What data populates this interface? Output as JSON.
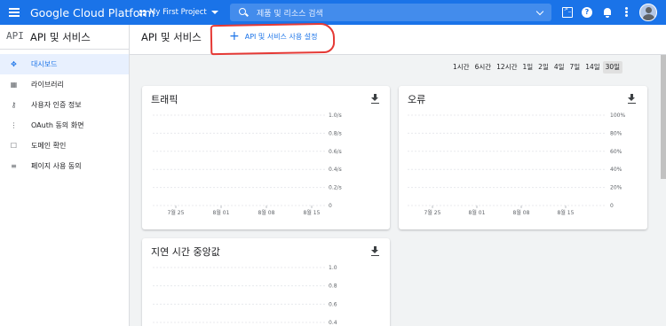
{
  "topbar": {
    "brand": "Google Cloud Platform",
    "project": "My First Project",
    "search_placeholder": "제품 및 리소스 검색",
    "help": "?",
    "colors": {
      "bar": "#1a73e8"
    }
  },
  "sidebar": {
    "api_logo": "API",
    "title": "API 및 서비스",
    "items": [
      {
        "label": "대시보드",
        "icon": "dashboard-icon",
        "glyph": "✥",
        "active": true
      },
      {
        "label": "라이브러리",
        "icon": "library-icon",
        "glyph": "▦",
        "active": false
      },
      {
        "label": "사용자 인증 정보",
        "icon": "key-icon",
        "glyph": "⚷",
        "active": false
      },
      {
        "label": "OAuth 동의 화면",
        "icon": "consent-icon",
        "glyph": "⋮",
        "active": false
      },
      {
        "label": "도메인 확인",
        "icon": "domain-icon",
        "glyph": "☐",
        "active": false
      },
      {
        "label": "페이지 사용 동의",
        "icon": "settings-list-icon",
        "glyph": "≡",
        "active": false
      }
    ]
  },
  "header": {
    "title": "API 및 서비스",
    "enable_button": "API 및 서비스 사용 설정",
    "enable_plus": "+"
  },
  "ranges": [
    "1시간",
    "6시간",
    "12시간",
    "1일",
    "2일",
    "4일",
    "7일",
    "14일",
    "30일"
  ],
  "ranges_selected": "30일",
  "chart_data": [
    {
      "type": "line",
      "title": "트래픽",
      "x": [
        "7월 25",
        "8월 01",
        "8월 08",
        "8월 15"
      ],
      "y_ticks": [
        "1.0/s",
        "0.8/s",
        "0.6/s",
        "0.4/s",
        "0.2/s",
        "0"
      ],
      "ylim": [
        0,
        1.0
      ],
      "series": [],
      "grid": true
    },
    {
      "type": "line",
      "title": "오류",
      "x": [
        "7월 25",
        "8월 01",
        "8월 08",
        "8월 15"
      ],
      "y_ticks": [
        "100%",
        "80%",
        "60%",
        "40%",
        "20%",
        "0"
      ],
      "ylim": [
        0,
        100
      ],
      "series": [],
      "grid": true
    },
    {
      "type": "line",
      "title": "지연 시간 중앙값",
      "x": [],
      "y_ticks": [
        "1.0",
        "0.8",
        "0.6",
        "0.4"
      ],
      "ylim": [
        0,
        1.0
      ],
      "series": [],
      "grid": true
    }
  ]
}
